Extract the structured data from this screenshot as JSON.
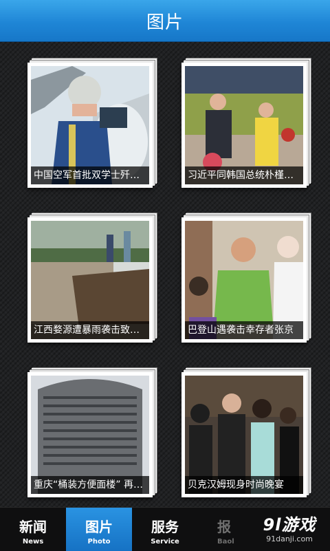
{
  "header": {
    "title": "图片"
  },
  "gallery": [
    {
      "caption": "中国空军首批双学士歼击机女飞行员"
    },
    {
      "caption": "习近平同韩国总统朴槿惠会谈"
    },
    {
      "caption": "江西婺源遭暴雨袭击致河岸垮塌"
    },
    {
      "caption": "巴登山遇袭击幸存者张京"
    },
    {
      "caption": "重庆“桶装方便面楼” 再引热议"
    },
    {
      "caption": "贝克汉姆现身时尚晚宴"
    }
  ],
  "tabs": [
    {
      "zh": "新闻",
      "en": "News"
    },
    {
      "zh": "图片",
      "en": "Photo"
    },
    {
      "zh": "服务",
      "en": "Service"
    },
    {
      "zh": "报",
      "en": "Baol"
    }
  ],
  "watermark": {
    "main": "9l游戏",
    "sub": "91danji.com"
  }
}
